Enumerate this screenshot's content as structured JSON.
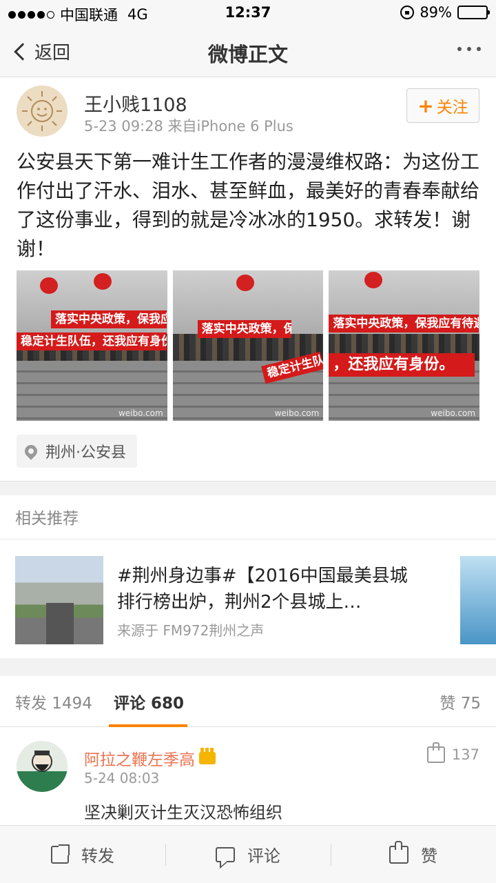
{
  "status_bar": {
    "carrier": "中国联通",
    "network": "4G",
    "time": "12:37",
    "battery": "89%",
    "battery_level": 0.89
  },
  "nav": {
    "back_label": "返回",
    "title": "微博正文"
  },
  "post": {
    "username": "王小贱1108",
    "meta": "5-23 09:28  来自iPhone 6 Plus",
    "follow_label": "关注",
    "text": "公安县天下第一难计生工作者的漫漫维权路：为这份工作付出了汗水、泪水、甚至鲜血，最美好的青春奉献给了这份事业，得到的就是冷冰冰的1950。求转发！谢谢！",
    "photos": [
      {
        "banners": [
          "落实中央政策，保我应有待",
          "稳定计生队伍，还我应有身份。"
        ],
        "watermark": "weibo.com"
      },
      {
        "banners": [
          "落实中央政策，保我应有",
          "稳定计生队伍，还我应"
        ],
        "watermark": "weibo.com"
      },
      {
        "banners": [
          "落实中央政策，保我应有待遇",
          "，还我应有身份。"
        ],
        "watermark": "weibo.com"
      }
    ],
    "location": "荆州·公安县"
  },
  "related": {
    "header": "相关推荐",
    "item": {
      "title": "#荆州身边事#【2016中国最美县城排行榜出炉，荆州2个县城上…",
      "source": "来源于 FM972荆州之声"
    }
  },
  "tabs": {
    "repost": "转发 1494",
    "comments": "评论 680",
    "likes": "赞 75"
  },
  "comment": {
    "name": "阿拉之鞭左季高",
    "time": "5-24 08:03",
    "text": "坚决剿灭计生灭汉恐怖组织",
    "likes": "137"
  },
  "bottom_bar": {
    "repost": "转发",
    "comment": "评论",
    "like": "赞"
  },
  "colors": {
    "accent": "#ff8200",
    "comment_name": "#eb7350",
    "banner_red": "#d41a1a"
  }
}
